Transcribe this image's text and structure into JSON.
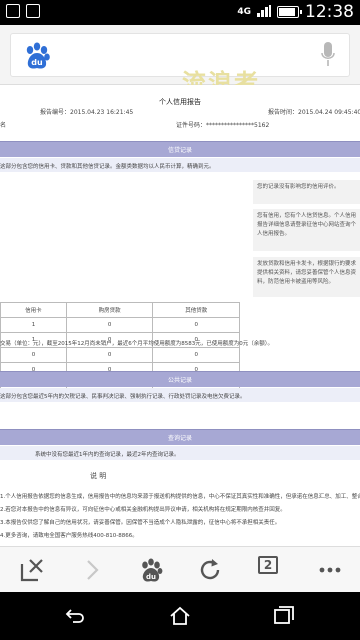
{
  "status_bar": {
    "network": "4G",
    "time": "12:38"
  },
  "address_bar": {
    "logo": "baidu-logo",
    "watermark": "流浪者"
  },
  "document": {
    "title": "个人信用报告",
    "meta_left_1": "报告编号：2015.04.23 16:21:45",
    "meta_right_1": "报告时间：2015.04.24 09:45:40",
    "meta_left_2": "名",
    "meta_right_2": "证件号码：****************5162",
    "sections": {
      "credit": "信贷记录",
      "public": "公共记录",
      "query": "查询记录"
    },
    "credit_summary": "这部分包含您的信用卡、贷款和其他信贷记录。金额类数据均以人民币计算，精确到元。",
    "side_note_1": "您的记录没有影响您的信用评价。",
    "side_note_2": "您有信用，您有个人信贷信息。个人信用报告详细信息请登录征信中心网站查询个人信用报告。",
    "side_note_3": "发放贷款和信用卡发卡，根据银行的要求提供相关资料，请您妥善保管个人信息资料，防范信用卡被盗用等风险。",
    "table": {
      "headers": [
        "信用卡",
        "购房贷款",
        "其他贷款"
      ],
      "rows": [
        [
          "1",
          "0",
          "0"
        ],
        [
          "1",
          "0",
          "0"
        ],
        [
          "0",
          "0",
          "0"
        ],
        [
          "0",
          "0",
          "0"
        ],
        [
          "0",
          "0",
          "0"
        ]
      ]
    },
    "credit_detail": "交易（单位：元），截至2015年12月尚未销户，最近6个月平均使用额度为8583元，已使用额度为0元（余额）。",
    "public_summary": "这部分包含您最近5年内的欠税记录、民事判决记录、强制执行记录、行政处罚记录及电信欠费记录。",
    "query_summary": "系统中没有您最近1年内的查询记录，最近2年内查询记录。",
    "explain_title": "说  明",
    "explain_1": "1.个人信用报告依据您的信息生成，信用报告中的信息均来源于报送机构提供的信息，中心不保证其真实性和准确性，但承诺在信息汇总、加工、整合的全过程中保持客观、中立的地位。",
    "explain_2": "2.若您对本报告中的信息有异议，可向征信中心或相关金融机构提出异议申请，相关机构将在规定期限内核查并回复。",
    "explain_3": "3.本报告仅供您了解自己的信用状况，请妥善保管。因保管不当造成个人隐私泄露的，征信中心将不承担相关责任。",
    "explain_4": "4.更多咨询，请致电全国客户服务热线400-810-8866。"
  },
  "toolbar": {
    "tab_count": "2",
    "icons": [
      "close-page-icon",
      "forward-icon",
      "baidu-home-icon",
      "refresh-icon",
      "tabs-icon",
      "more-icon"
    ]
  },
  "nav_bar": {
    "icons": [
      "back-icon",
      "home-icon",
      "recent-apps-icon"
    ]
  },
  "colors": {
    "section_bar": "#a7a8d4",
    "light_row": "#eceef8",
    "baidu_blue": "#2f6fd6"
  }
}
